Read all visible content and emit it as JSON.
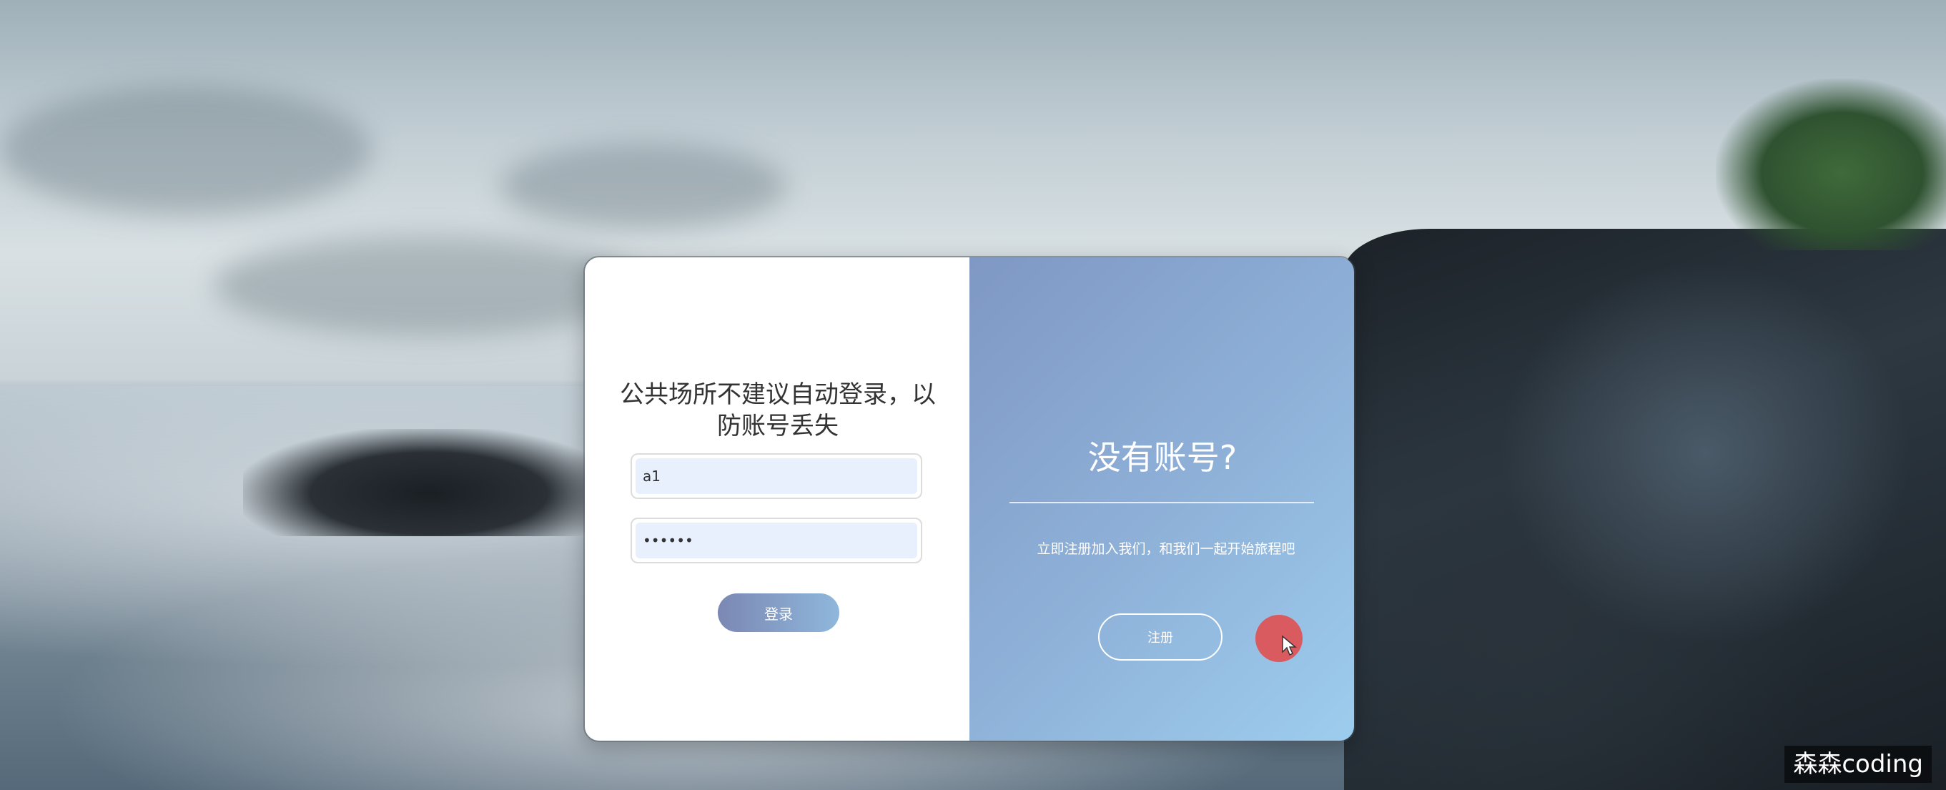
{
  "login": {
    "title": "公共场所不建议自动登录，以防账号丢失",
    "username_value": "a1",
    "password_value": "••••••",
    "login_button": "登录"
  },
  "register": {
    "title": "没有账号?",
    "description": "立即注册加入我们，和我们一起开始旅程吧",
    "register_button": "注册"
  },
  "watermark": "森森coding",
  "colors": {
    "panel_gradient_start": "#7f98c4",
    "panel_gradient_end": "#9dcdee",
    "login_button_start": "#7b88b3",
    "login_button_end": "#8fb7dc",
    "input_fill": "#e8f0fe",
    "click_indicator": "#e15050"
  },
  "icons": {
    "cursor": "mouse-pointer-icon"
  }
}
